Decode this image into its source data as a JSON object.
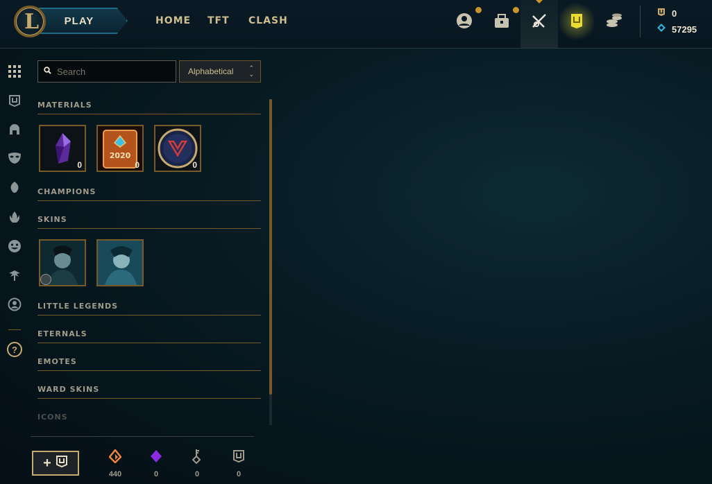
{
  "header": {
    "play_label": "PLAY",
    "logo_letter": "L",
    "nav": [
      {
        "label": "HOME"
      },
      {
        "label": "TFT"
      },
      {
        "label": "CLASH"
      }
    ],
    "icons": [
      "profile-icon",
      "collection-icon",
      "loot-icon",
      "store-icon",
      "currency-icon"
    ],
    "currencies": {
      "blue_essence": "0",
      "orange": "57295"
    }
  },
  "rail": {
    "icons": [
      "grid-icon",
      "chest-icon",
      "champion-helmet-icon",
      "skin-mask-icon",
      "little-legend-icon",
      "eternal-flame-icon",
      "emote-icon",
      "ward-icon",
      "profile-icon"
    ],
    "help_label": "?"
  },
  "search": {
    "placeholder": "Search"
  },
  "sort": {
    "selected": "Alphabetical"
  },
  "sections": {
    "materials": "MATERIALS",
    "champions": "CHAMPIONS",
    "skins": "SKINS",
    "little_legends": "LITTLE LEGENDS",
    "eternals": "ETERNALS",
    "emotes": "EMOTES",
    "ward_skins": "WARD SKINS",
    "icons": "ICONS"
  },
  "materials": [
    {
      "name": "Mythic crystal",
      "count": "0"
    },
    {
      "name": "2020 capsule",
      "count": "0"
    },
    {
      "name": "Worlds orb",
      "count": "0"
    }
  ],
  "skins": [
    {
      "name": "Skin 1"
    },
    {
      "name": "Skin 2"
    }
  ],
  "footer": {
    "add_label": "+",
    "stats": [
      {
        "icon": "orange-essence-icon",
        "value": "440"
      },
      {
        "icon": "mythic-essence-icon",
        "value": "0"
      },
      {
        "icon": "key-icon",
        "value": "0"
      },
      {
        "icon": "chest-icon",
        "value": "0"
      }
    ]
  },
  "colors": {
    "gold": "#c8aa6e",
    "dark_gold": "#785a28",
    "blue": "#0ac8b9",
    "purple": "#8a2be2",
    "orange": "#f0843c"
  }
}
